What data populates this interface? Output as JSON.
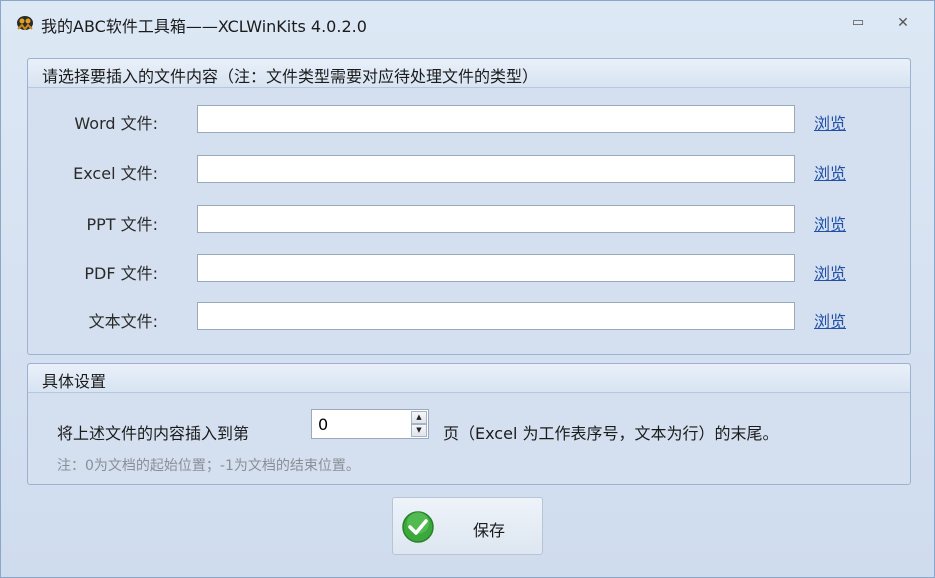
{
  "window": {
    "title": "我的ABC软件工具箱——XCLWinKits  4.0.2.0",
    "minimize_glyph": "▭",
    "close_glyph": "✕"
  },
  "file_group": {
    "title": "请选择要插入的文件内容（注：文件类型需要对应待处理文件的类型）",
    "rows": [
      {
        "label": "Word 文件:",
        "value": "",
        "browse": "浏览"
      },
      {
        "label": "Excel 文件:",
        "value": "",
        "browse": "浏览"
      },
      {
        "label": "PPT 文件:",
        "value": "",
        "browse": "浏览"
      },
      {
        "label": "PDF 文件:",
        "value": "",
        "browse": "浏览"
      },
      {
        "label": "文本文件:",
        "value": "",
        "browse": "浏览"
      }
    ]
  },
  "settings_group": {
    "title": "具体设置",
    "insert_label": "将上述文件的内容插入到第",
    "page_value": "0",
    "suffix": "页（Excel 为工作表序号，文本为行）的末尾。",
    "note": "注：0为文档的起始位置；-1为文档的结束位置。"
  },
  "save_button": {
    "label": "保存",
    "icon": "green-check-icon"
  },
  "colors": {
    "window_bg": "#d4e0ef",
    "link": "#1f4fa8",
    "note_text": "#8a8f97",
    "check_green": "#3aa83a"
  }
}
